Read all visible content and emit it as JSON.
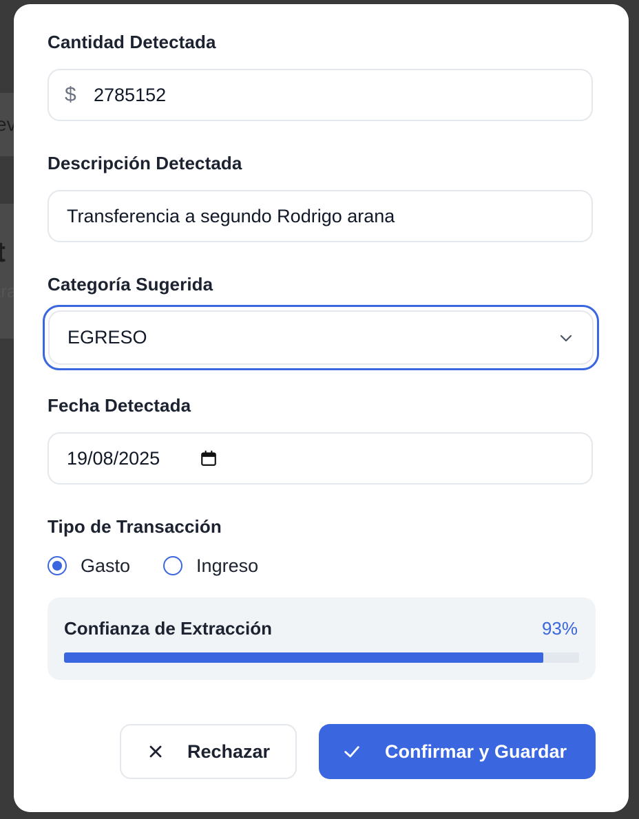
{
  "background": {
    "fragments": [
      "ev",
      "t",
      "tra"
    ]
  },
  "form": {
    "amount": {
      "label": "Cantidad Detectada",
      "currency_symbol": "$",
      "value": "2785152"
    },
    "description": {
      "label": "Descripción Detectada",
      "value": "Transferencia a segundo Rodrigo arana"
    },
    "category": {
      "label": "Categoría Sugerida",
      "selected": "EGRESO",
      "icon": "chevron-down-icon"
    },
    "date": {
      "label": "Fecha Detectada",
      "value": "19/08/2025",
      "icon": "calendar-icon"
    },
    "transaction_type": {
      "label": "Tipo de Transacción",
      "options": [
        {
          "label": "Gasto",
          "checked": true
        },
        {
          "label": "Ingreso",
          "checked": false
        }
      ]
    },
    "confidence": {
      "label": "Confianza de Extracción",
      "value_text": "93%",
      "percent": 93
    }
  },
  "actions": {
    "reject_label": "Rechazar",
    "reject_icon": "close-icon",
    "confirm_label": "Confirmar y Guardar",
    "confirm_icon": "check-icon"
  },
  "colors": {
    "accent": "#3a66e0",
    "text": "#1c2230",
    "border": "#e4e7ec",
    "panel": "#f1f4f7"
  }
}
